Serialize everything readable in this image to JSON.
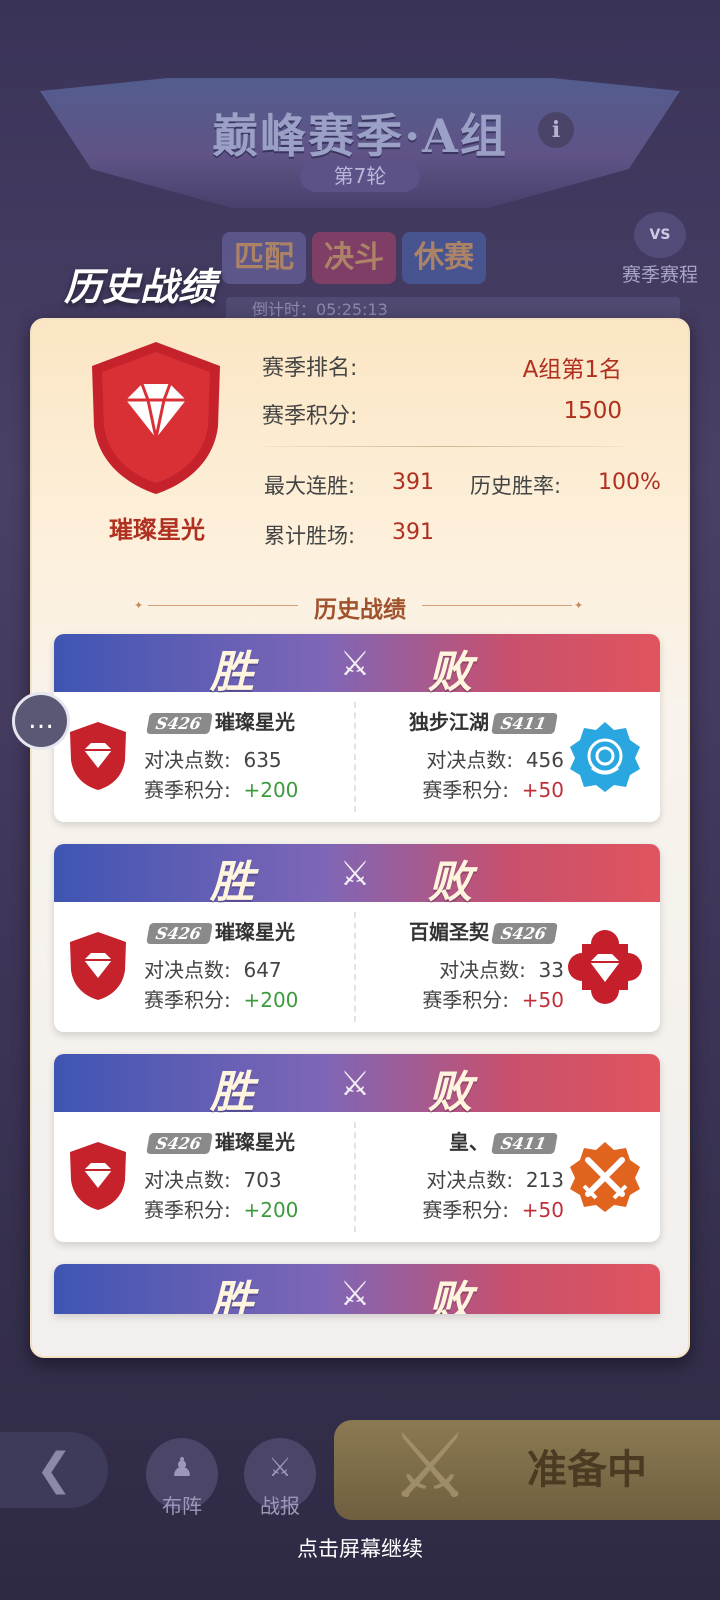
{
  "background": {
    "season_title": "巅峰赛季·A组",
    "round": "第7轮",
    "info_icon": "i",
    "schedule_label": "赛季赛程",
    "schedule_icon_text": "VS",
    "phases": [
      "匹配",
      "决斗",
      "休赛"
    ],
    "countdown": "倒计时：05:25:13",
    "bottom": {
      "formation_label": "布阵",
      "report_label": "战报",
      "ready_label": "准备中"
    },
    "continue_hint": "点击屏幕继续"
  },
  "history": {
    "heading": "历史战绩",
    "player": {
      "name": "璀璨星光",
      "season_rank_label": "赛季排名:",
      "season_rank_value": "A组第1名",
      "season_points_label": "赛季积分:",
      "season_points_value": "1500",
      "max_streak_label": "最大连胜:",
      "max_streak_value": "391",
      "win_rate_label": "历史胜率:",
      "win_rate_value": "100%",
      "total_wins_label": "累计胜场:",
      "total_wins_value": "391"
    },
    "section_title": "历史战绩",
    "win_label": "胜",
    "lose_label": "败",
    "duel_points_label": "对决点数:",
    "season_points_label": "赛季积分:",
    "matches": [
      {
        "left_server": "S426",
        "left_name": "璀璨星光",
        "left_points": "635",
        "left_delta": "+200",
        "right_server": "S411",
        "right_name": "独步江湖",
        "right_points": "456",
        "right_delta": "+50",
        "right_icon": "rose-icon",
        "right_color": "#2aa6e0"
      },
      {
        "left_server": "S426",
        "left_name": "璀璨星光",
        "left_points": "647",
        "left_delta": "+200",
        "right_server": "S426",
        "right_name": "百媚圣契",
        "right_points": "33",
        "right_delta": "+50",
        "right_icon": "diamond-flower-icon",
        "right_color": "#c41f2a"
      },
      {
        "left_server": "S426",
        "left_name": "璀璨星光",
        "left_points": "703",
        "left_delta": "+200",
        "right_server": "S411",
        "right_name": "皇、",
        "right_points": "213",
        "right_delta": "+50",
        "right_icon": "crossed-swords-icon",
        "right_color": "#e0641e"
      }
    ]
  }
}
